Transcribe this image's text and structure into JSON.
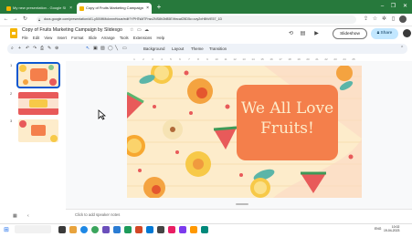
{
  "browser": {
    "tabs": [
      {
        "label": "My new presentation - Google Sl",
        "active": false
      },
      {
        "label": "Copy of Fruits Marketing Campaign",
        "active": true
      }
    ],
    "new_tab": "+",
    "window_controls": [
      "–",
      "❐",
      "✕"
    ],
    "url": "docs.google.com/presentation/d/1-y5XMtMcknnnHoue/edit?YPHTsM7Fnsv2NS8h3hB5E/thrcaiO5D5c=cvy2xH8hVE57_1D"
  },
  "app": {
    "title": "Copy of Fruits Marketing Campaign by Slidesgo",
    "menu": [
      "File",
      "Edit",
      "View",
      "Insert",
      "Format",
      "Slide",
      "Arrange",
      "Tools",
      "Extensions",
      "Help"
    ],
    "slideshow_label": "Slideshow",
    "share_label": "Share"
  },
  "toolbar": {
    "background_label": "Background",
    "layout_label": "Layout",
    "theme_label": "Theme",
    "transition_label": "Transition"
  },
  "ruler": [
    "1",
    "2",
    "3",
    "4",
    "5",
    "6",
    "7",
    "8",
    "9",
    "10",
    "11",
    "12",
    "13",
    "14",
    "15",
    "16",
    "17",
    "18",
    "19",
    "20",
    "21",
    "22",
    "23",
    "24",
    "25"
  ],
  "filmstrip": [
    {
      "number": "1",
      "title": "We All Love Fruits!",
      "selected": true
    },
    {
      "number": "2",
      "title": "",
      "selected": false
    },
    {
      "number": "3",
      "title": "",
      "selected": false
    }
  ],
  "slide": {
    "headline_line1": "We All Love",
    "headline_line2": "Fruits!",
    "background": "#fdeccb",
    "panel_color": "#f47f4b"
  },
  "notes_placeholder": "Click to add speaker notes",
  "taskbar": {
    "lang": "ENG",
    "time": "10:02",
    "date": "19-04-2023"
  },
  "colors": {
    "tabstrip": "#27793c",
    "accent": "#0b57d0"
  }
}
